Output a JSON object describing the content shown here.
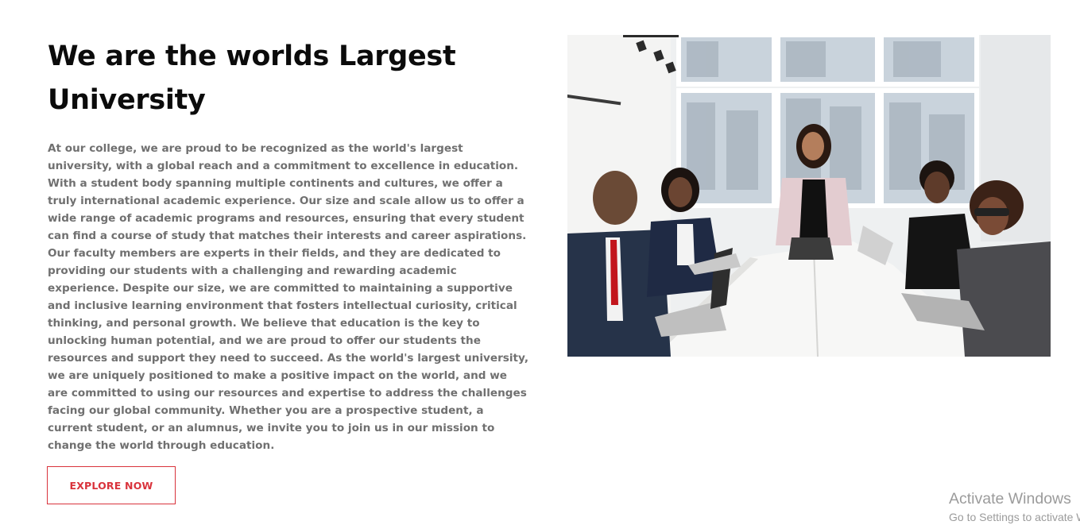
{
  "about": {
    "title": "We are the worlds Largest University",
    "body": "At our college, we are proud to be recognized as the world's largest university, with a global reach and a commitment to excellence in education. With a student body spanning multiple continents and cultures, we offer a truly international academic experience. Our size and scale allow us to offer a wide range of academic programs and resources, ensuring that every student can find a course of study that matches their interests and career aspirations. Our faculty members are experts in their fields, and they are dedicated to providing our students with a challenging and rewarding academic experience. Despite our size, we are committed to maintaining a supportive and inclusive learning environment that fosters intellectual curiosity, critical thinking, and personal growth. We believe that education is the key to unlocking human potential, and we are proud to offer our students the resources and support they need to succeed. As the world's largest university, we are uniquely positioned to make a positive impact on the world, and we are committed to using our resources and expertise to address the challenges facing our global community. Whether you are a prospective student, a current student, or an alumnus, we invite you to join us in our mission to change the world through education.",
    "button_label": "EXPLORE NOW"
  },
  "watermark": {
    "title": "Activate Windows",
    "subtitle": "Go to Settings to activate Windows."
  },
  "colors": {
    "accent": "#d9333c",
    "heading": "#0b0b0b",
    "body_text": "#707070"
  }
}
